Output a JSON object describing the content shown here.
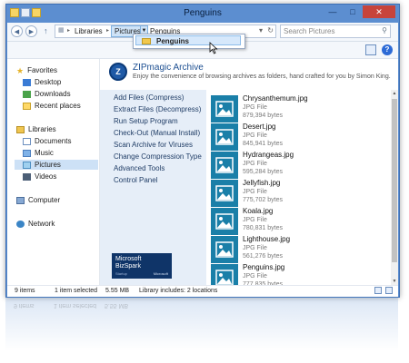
{
  "window": {
    "title": "Penguins"
  },
  "address": {
    "path": [
      "Libraries",
      "Pictures",
      "Penguins"
    ],
    "search_placeholder": "Search Pictures"
  },
  "dropdown": {
    "item": "Penguins"
  },
  "nav": {
    "favorites": {
      "label": "Favorites",
      "items": [
        "Desktop",
        "Downloads",
        "Recent places"
      ]
    },
    "libraries": {
      "label": "Libraries",
      "items": [
        "Documents",
        "Music",
        "Pictures",
        "Videos"
      ],
      "selected": "Pictures"
    },
    "computer": "Computer",
    "network": "Network"
  },
  "zipmagic": {
    "title": "ZIPmagic Archive",
    "tagline": "Enjoy the convenience of browsing archives as folders, hand crafted for you by Simon King.",
    "commands": [
      "Add Files (Compress)",
      "Extract Files (Decompress)",
      "Run Setup Program",
      "Check-Out (Manual Install)",
      "Scan Archive for Viruses",
      "Change Compression Type",
      "Advanced Tools",
      "Control Panel"
    ],
    "badge": {
      "line1": "Microsoft",
      "line2": "BizSpark",
      "line3": "Startup",
      "logo": "Microsoft"
    }
  },
  "files": [
    {
      "name": "Chrysanthemum.jpg",
      "type": "JPG File",
      "size": "879,394 bytes"
    },
    {
      "name": "Desert.jpg",
      "type": "JPG File",
      "size": "845,941 bytes"
    },
    {
      "name": "Hydrangeas.jpg",
      "type": "JPG File",
      "size": "595,284 bytes"
    },
    {
      "name": "Jellyfish.jpg",
      "type": "JPG File",
      "size": "775,702 bytes"
    },
    {
      "name": "Koala.jpg",
      "type": "JPG File",
      "size": "780,831 bytes"
    },
    {
      "name": "Lighthouse.jpg",
      "type": "JPG File",
      "size": "561,276 bytes"
    },
    {
      "name": "Penguins.jpg",
      "type": "JPG File",
      "size": "777,835 bytes"
    }
  ],
  "status": {
    "items": "9 items",
    "selected": "1 item selected",
    "size": "5.55 MB",
    "library": "Library includes: 2 locations"
  },
  "icons": {
    "back": "back-arrow-icon",
    "forward": "forward-arrow-icon",
    "up": "up-arrow-icon",
    "refresh": "refresh-icon",
    "search": "search-icon",
    "help": "help-icon",
    "file_thumb": "image-file-icon"
  },
  "colors": {
    "title_bar": "#5c8ed0",
    "accent": "#1d4f91",
    "close": "#c7443b",
    "thumb": "#1a7fa8"
  }
}
